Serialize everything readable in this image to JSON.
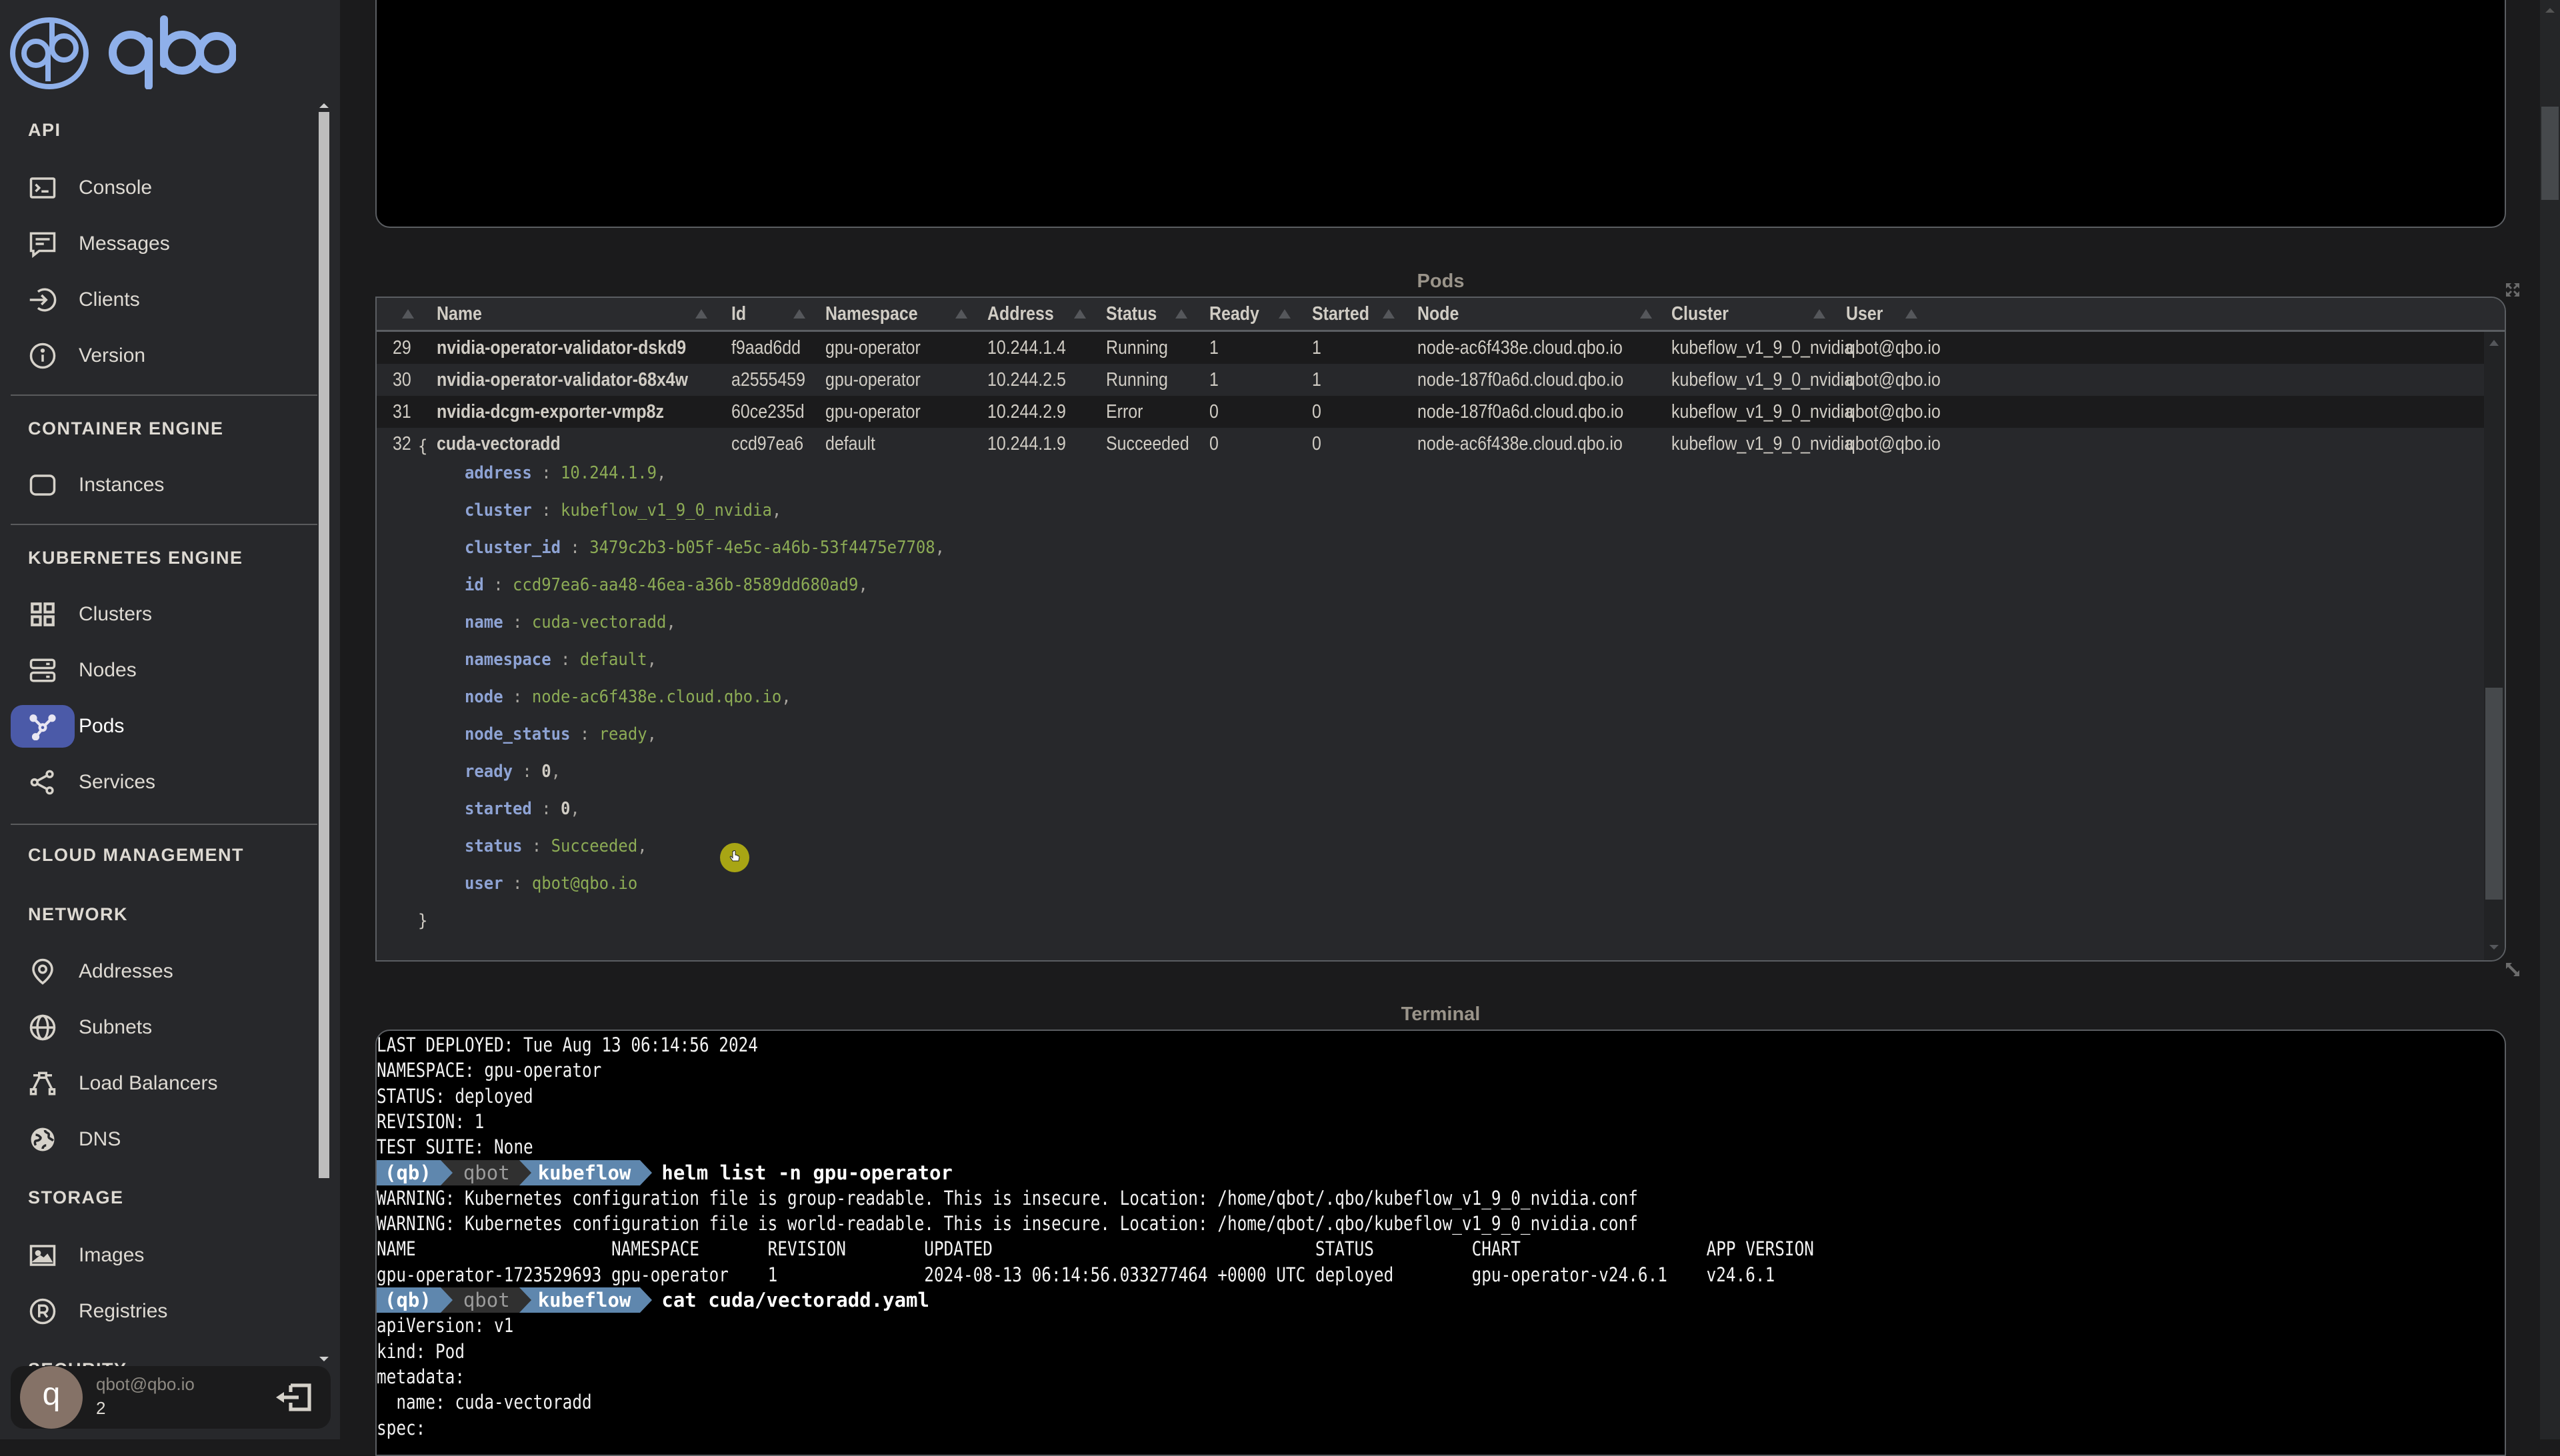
{
  "brand": {
    "name": "qbo",
    "logo_color": "#8fb0ea"
  },
  "sidebar": {
    "sections": [
      {
        "title": "API",
        "items": [
          {
            "label": "Console",
            "icon": "terminal-icon"
          },
          {
            "label": "Messages",
            "icon": "message-icon"
          },
          {
            "label": "Clients",
            "icon": "login-icon"
          },
          {
            "label": "Version",
            "icon": "info-icon"
          }
        ]
      },
      {
        "title": "CONTAINER ENGINE",
        "items": [
          {
            "label": "Instances",
            "icon": "square-icon"
          }
        ]
      },
      {
        "title": "KUBERNETES ENGINE",
        "items": [
          {
            "label": "Clusters",
            "icon": "grid-icon"
          },
          {
            "label": "Nodes",
            "icon": "server-icon"
          },
          {
            "label": "Pods",
            "icon": "pods-icon",
            "active": true
          },
          {
            "label": "Services",
            "icon": "share-icon"
          }
        ]
      },
      {
        "title": "CLOUD MANAGEMENT",
        "items": []
      },
      {
        "title": "NETWORK",
        "items": [
          {
            "label": "Addresses",
            "icon": "location-icon"
          },
          {
            "label": "Subnets",
            "icon": "globe-icon"
          },
          {
            "label": "Load Balancers",
            "icon": "load-balancer-icon"
          },
          {
            "label": "DNS",
            "icon": "earth-icon"
          }
        ]
      },
      {
        "title": "STORAGE",
        "items": [
          {
            "label": "Images",
            "icon": "image-icon"
          },
          {
            "label": "Registries",
            "icon": "registered-icon"
          }
        ]
      },
      {
        "title": "SECURITY",
        "items": []
      }
    ],
    "user": {
      "avatar_letter": "q",
      "email": "qbot@qbo.io",
      "count": "2"
    },
    "active_color": "#4b5aa8"
  },
  "pods": {
    "title": "Pods",
    "columns": [
      "",
      "Name",
      "Id",
      "Namespace",
      "Address",
      "Status",
      "Ready",
      "Started",
      "Node",
      "Cluster",
      "User"
    ],
    "rows": [
      {
        "num": "29",
        "name": "nvidia-operator-validator-dskd9",
        "id": "f9aad6dd",
        "namespace": "gpu-operator",
        "address": "10.244.1.4",
        "status": "Running",
        "ready": "1",
        "started": "1",
        "node": "node-ac6f438e.cloud.qbo.io",
        "cluster": "kubeflow_v1_9_0_nvidia",
        "user": "qbot@qbo.io"
      },
      {
        "num": "30",
        "name": "nvidia-operator-validator-68x4w",
        "id": "a2555459",
        "namespace": "gpu-operator",
        "address": "10.244.2.5",
        "status": "Running",
        "ready": "1",
        "started": "1",
        "node": "node-187f0a6d.cloud.qbo.io",
        "cluster": "kubeflow_v1_9_0_nvidia",
        "user": "qbot@qbo.io"
      },
      {
        "num": "31",
        "name": "nvidia-dcgm-exporter-vmp8z",
        "id": "60ce235d",
        "namespace": "gpu-operator",
        "address": "10.244.2.9",
        "status": "Error",
        "ready": "0",
        "started": "0",
        "node": "node-187f0a6d.cloud.qbo.io",
        "cluster": "kubeflow_v1_9_0_nvidia",
        "user": "qbot@qbo.io"
      },
      {
        "num": "32",
        "name": "cuda-vectoradd",
        "id": "ccd97ea6",
        "namespace": "default",
        "address": "10.244.1.9",
        "status": "Succeeded",
        "ready": "0",
        "started": "0",
        "node": "node-ac6f438e.cloud.qbo.io",
        "cluster": "kubeflow_v1_9_0_nvidia",
        "user": "qbot@qbo.io"
      }
    ],
    "detail": {
      "open": "{",
      "close": "}",
      "fields": [
        {
          "key": "address",
          "value": "10.244.1.9",
          "type": "string"
        },
        {
          "key": "cluster",
          "value": "kubeflow_v1_9_0_nvidia",
          "type": "string"
        },
        {
          "key": "cluster_id",
          "value": "3479c2b3-b05f-4e5c-a46b-53f4475e7708",
          "type": "string"
        },
        {
          "key": "id",
          "value": "ccd97ea6-aa48-46ea-a36b-8589dd680ad9",
          "type": "string"
        },
        {
          "key": "name",
          "value": "cuda-vectoradd",
          "type": "string"
        },
        {
          "key": "namespace",
          "value": "default",
          "type": "string"
        },
        {
          "key": "node",
          "value": "node-ac6f438e.cloud.qbo.io",
          "type": "string"
        },
        {
          "key": "node_status",
          "value": "ready",
          "type": "string"
        },
        {
          "key": "ready",
          "value": "0",
          "type": "number"
        },
        {
          "key": "started",
          "value": "0",
          "type": "number"
        },
        {
          "key": "status",
          "value": "Succeeded",
          "type": "string"
        },
        {
          "key": "user",
          "value": "qbot@qbo.io",
          "type": "string",
          "last": true
        }
      ]
    }
  },
  "terminal": {
    "title": "Terminal",
    "prompt": {
      "env": "(qb)",
      "user": "qbot",
      "dir": "kubeflow"
    },
    "lines": [
      {
        "type": "out",
        "text": "LAST DEPLOYED: Tue Aug 13 06:14:56 2024"
      },
      {
        "type": "out",
        "text": "NAMESPACE: gpu-operator"
      },
      {
        "type": "out",
        "text": "STATUS: deployed"
      },
      {
        "type": "out",
        "text": "REVISION: 1"
      },
      {
        "type": "out",
        "text": "TEST SUITE: None"
      },
      {
        "type": "cmd",
        "text": "helm list -n gpu-operator"
      },
      {
        "type": "out",
        "text": "WARNING: Kubernetes configuration file is group-readable. This is insecure. Location: /home/qbot/.qbo/kubeflow_v1_9_0_nvidia.conf"
      },
      {
        "type": "out",
        "text": "WARNING: Kubernetes configuration file is world-readable. This is insecure. Location: /home/qbot/.qbo/kubeflow_v1_9_0_nvidia.conf"
      },
      {
        "type": "out",
        "text": "NAME                    NAMESPACE       REVISION        UPDATED                                 STATUS          CHART                   APP VERSION"
      },
      {
        "type": "out",
        "text": "gpu-operator-1723529693 gpu-operator    1               2024-08-13 06:14:56.033277464 +0000 UTC deployed        gpu-operator-v24.6.1    v24.6.1"
      },
      {
        "type": "cmd",
        "text": "cat cuda/vectoradd.yaml"
      },
      {
        "type": "out",
        "text": "apiVersion: v1"
      },
      {
        "type": "out",
        "text": "kind: Pod"
      },
      {
        "type": "out",
        "text": "metadata:"
      },
      {
        "type": "out",
        "text": "  name: cuda-vectoradd"
      },
      {
        "type": "out",
        "text": "spec:"
      }
    ]
  }
}
